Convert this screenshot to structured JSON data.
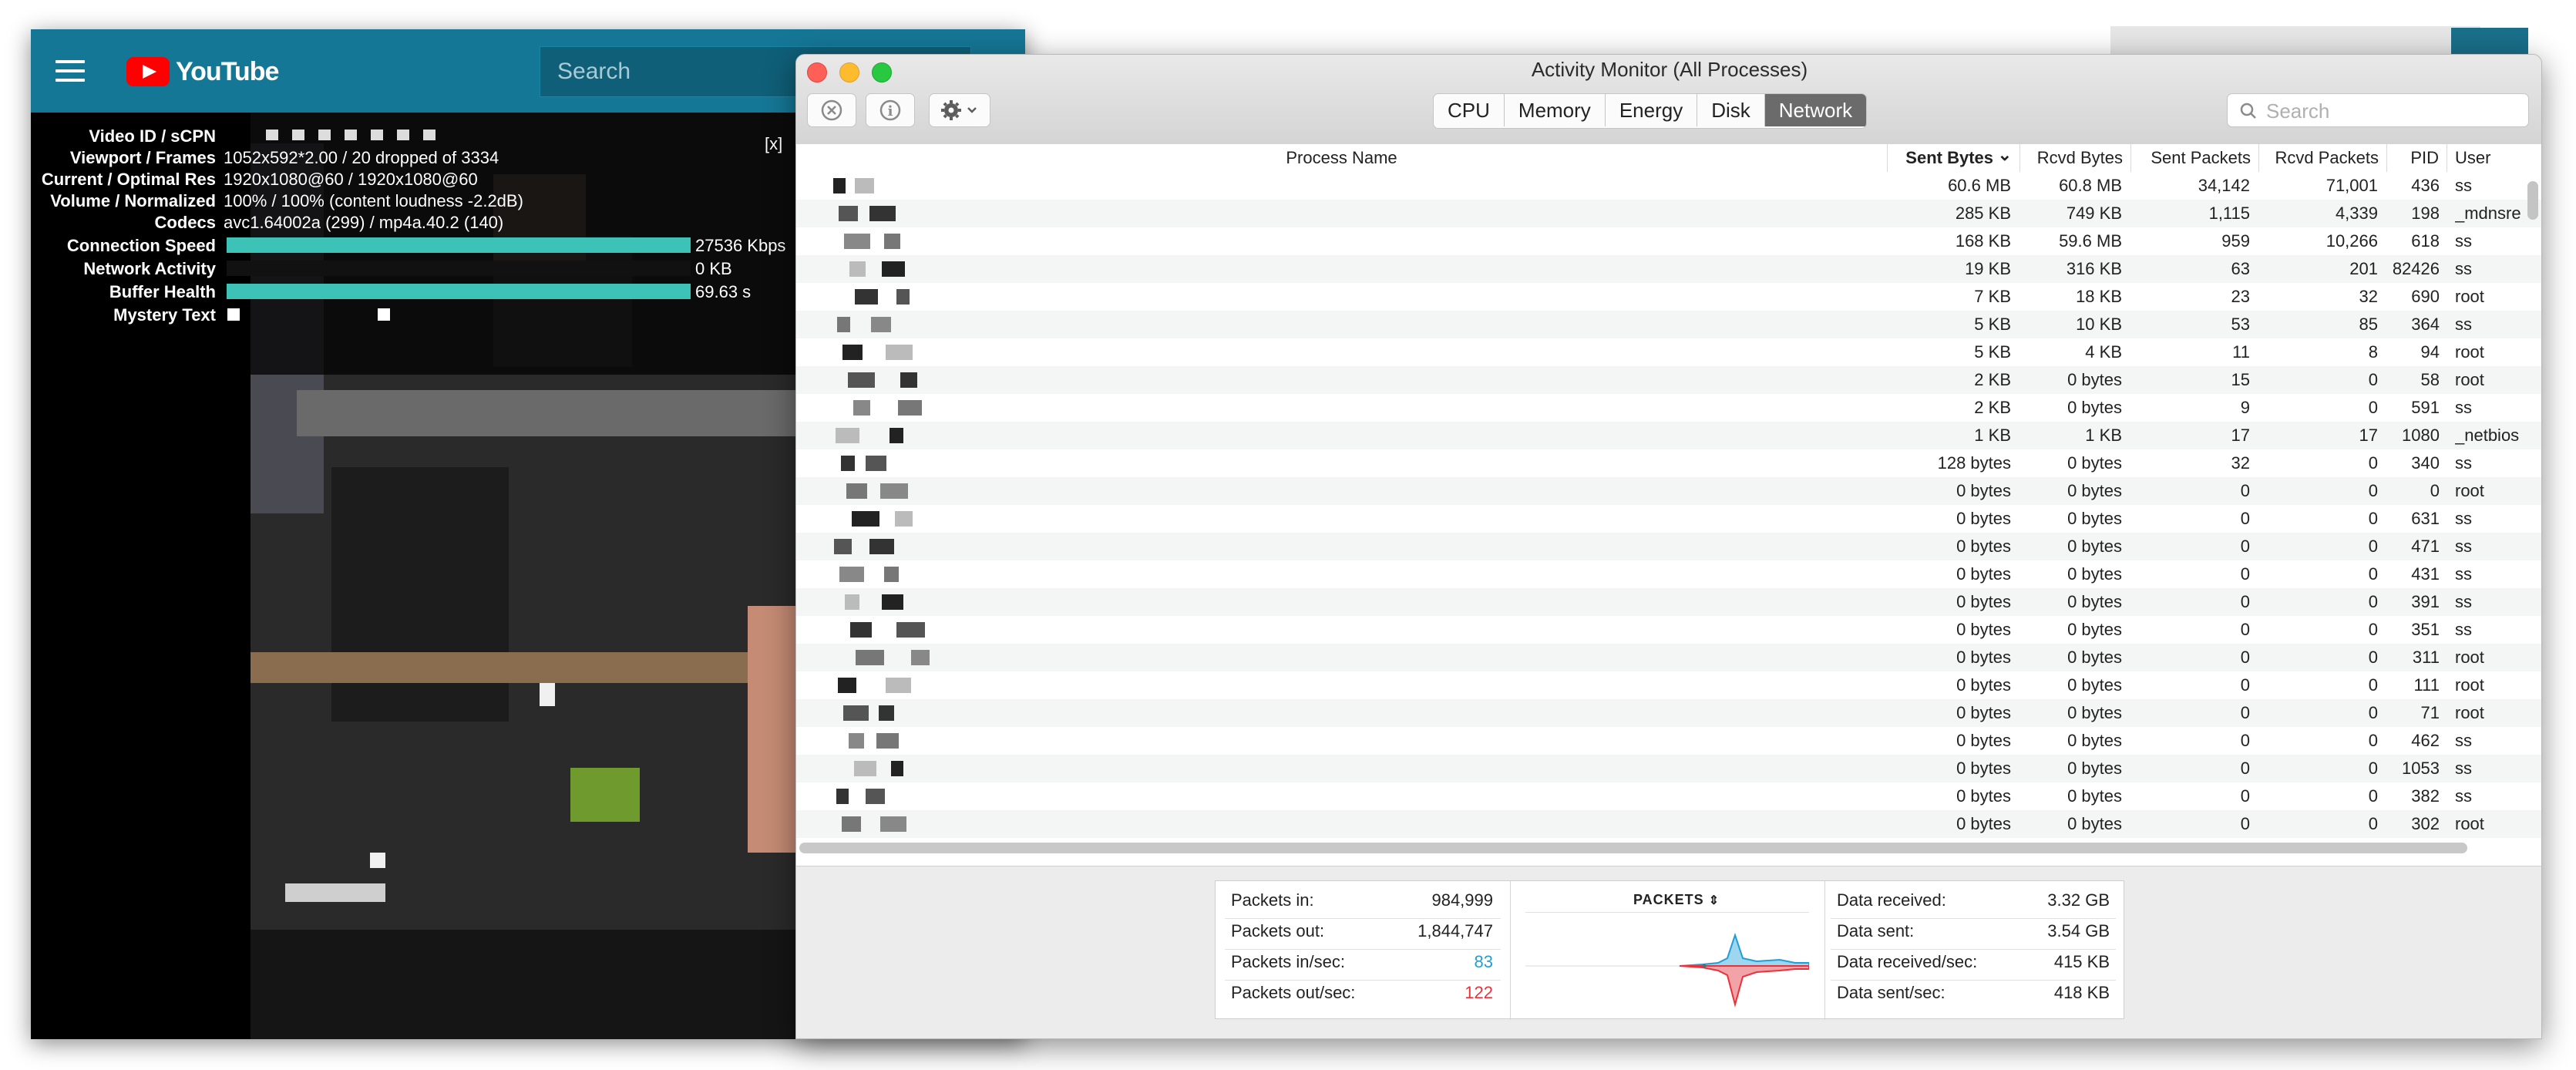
{
  "youtube": {
    "logo_text": "YouTube",
    "search_placeholder": "Search",
    "stats": [
      {
        "label": "Video ID / sCPN",
        "value": ""
      },
      {
        "label": "Viewport / Frames",
        "value": "1052x592*2.00 / 20 dropped of 3334"
      },
      {
        "label": "Current / Optimal Res",
        "value": "1920x1080@60 / 1920x1080@60"
      },
      {
        "label": "Volume / Normalized",
        "value": "100% / 100% (content loudness -2.2dB)"
      },
      {
        "label": "Codecs",
        "value": "avc1.64002a (299) / mp4a.40.2 (140)"
      },
      {
        "label": "Connection Speed",
        "value": "27536 Kbps",
        "fill": 1.0
      },
      {
        "label": "Network Activity",
        "value": "0 KB",
        "fill": 0.0
      },
      {
        "label": "Buffer Health",
        "value": "69.63 s",
        "fill": 1.0
      },
      {
        "label": "Mystery Text",
        "value": ""
      }
    ],
    "close_label": "[x]",
    "colors": {
      "header": "#157796",
      "bar_dark": "#0e8f9b",
      "bar_light": "#3cc2b6"
    }
  },
  "activity_monitor": {
    "title": "Activity Monitor (All Processes)",
    "toolbar_icons": [
      "close-process-icon",
      "info-icon",
      "gear-icon"
    ],
    "tabs": [
      {
        "label": "CPU",
        "active": false
      },
      {
        "label": "Memory",
        "active": false
      },
      {
        "label": "Energy",
        "active": false
      },
      {
        "label": "Disk",
        "active": false
      },
      {
        "label": "Network",
        "active": true
      }
    ],
    "search_placeholder": "Search",
    "columns": [
      "Process Name",
      "Sent Bytes",
      "Rcvd Bytes",
      "Sent Packets",
      "Rcvd Packets",
      "PID",
      "User"
    ],
    "sort_indicator": "⌄",
    "rows": [
      {
        "sent": "60.6 MB",
        "rcvd": "60.8 MB",
        "spk": "34,142",
        "rpk": "71,001",
        "pid": "436",
        "user": "ss"
      },
      {
        "sent": "285 KB",
        "rcvd": "749 KB",
        "spk": "1,115",
        "rpk": "4,339",
        "pid": "198",
        "user": "_mdnsre"
      },
      {
        "sent": "168 KB",
        "rcvd": "59.6 MB",
        "spk": "959",
        "rpk": "10,266",
        "pid": "618",
        "user": "ss"
      },
      {
        "sent": "19 KB",
        "rcvd": "316 KB",
        "spk": "63",
        "rpk": "201",
        "pid": "82426",
        "user": "ss"
      },
      {
        "sent": "7 KB",
        "rcvd": "18 KB",
        "spk": "23",
        "rpk": "32",
        "pid": "690",
        "user": "root"
      },
      {
        "sent": "5 KB",
        "rcvd": "10 KB",
        "spk": "53",
        "rpk": "85",
        "pid": "364",
        "user": "ss"
      },
      {
        "sent": "5 KB",
        "rcvd": "4 KB",
        "spk": "11",
        "rpk": "8",
        "pid": "94",
        "user": "root"
      },
      {
        "sent": "2 KB",
        "rcvd": "0 bytes",
        "spk": "15",
        "rpk": "0",
        "pid": "58",
        "user": "root"
      },
      {
        "sent": "2 KB",
        "rcvd": "0 bytes",
        "spk": "9",
        "rpk": "0",
        "pid": "591",
        "user": "ss"
      },
      {
        "sent": "1 KB",
        "rcvd": "1 KB",
        "spk": "17",
        "rpk": "17",
        "pid": "1080",
        "user": "_netbios"
      },
      {
        "sent": "128 bytes",
        "rcvd": "0 bytes",
        "spk": "32",
        "rpk": "0",
        "pid": "340",
        "user": "ss"
      },
      {
        "sent": "0 bytes",
        "rcvd": "0 bytes",
        "spk": "0",
        "rpk": "0",
        "pid": "0",
        "user": "root"
      },
      {
        "sent": "0 bytes",
        "rcvd": "0 bytes",
        "spk": "0",
        "rpk": "0",
        "pid": "631",
        "user": "ss"
      },
      {
        "sent": "0 bytes",
        "rcvd": "0 bytes",
        "spk": "0",
        "rpk": "0",
        "pid": "471",
        "user": "ss"
      },
      {
        "sent": "0 bytes",
        "rcvd": "0 bytes",
        "spk": "0",
        "rpk": "0",
        "pid": "431",
        "user": "ss"
      },
      {
        "sent": "0 bytes",
        "rcvd": "0 bytes",
        "spk": "0",
        "rpk": "0",
        "pid": "391",
        "user": "ss"
      },
      {
        "sent": "0 bytes",
        "rcvd": "0 bytes",
        "spk": "0",
        "rpk": "0",
        "pid": "351",
        "user": "ss"
      },
      {
        "sent": "0 bytes",
        "rcvd": "0 bytes",
        "spk": "0",
        "rpk": "0",
        "pid": "311",
        "user": "root"
      },
      {
        "sent": "0 bytes",
        "rcvd": "0 bytes",
        "spk": "0",
        "rpk": "0",
        "pid": "111",
        "user": "root"
      },
      {
        "sent": "0 bytes",
        "rcvd": "0 bytes",
        "spk": "0",
        "rpk": "0",
        "pid": "71",
        "user": "root"
      },
      {
        "sent": "0 bytes",
        "rcvd": "0 bytes",
        "spk": "0",
        "rpk": "0",
        "pid": "462",
        "user": "ss"
      },
      {
        "sent": "0 bytes",
        "rcvd": "0 bytes",
        "spk": "0",
        "rpk": "0",
        "pid": "1053",
        "user": "ss"
      },
      {
        "sent": "0 bytes",
        "rcvd": "0 bytes",
        "spk": "0",
        "rpk": "0",
        "pid": "382",
        "user": "ss"
      },
      {
        "sent": "0 bytes",
        "rcvd": "0 bytes",
        "spk": "0",
        "rpk": "0",
        "pid": "302",
        "user": "root"
      }
    ],
    "summary_left": [
      {
        "label": "Packets in:",
        "value": "984,999"
      },
      {
        "label": "Packets out:",
        "value": "1,844,747"
      },
      {
        "label": "Packets in/sec:",
        "value": "83"
      },
      {
        "label": "Packets out/sec:",
        "value": "122"
      }
    ],
    "graph_title": "PACKETS",
    "summary_right": [
      {
        "label": "Data received:",
        "value": "3.32 GB"
      },
      {
        "label": "Data sent:",
        "value": "3.54 GB"
      },
      {
        "label": "Data received/sec:",
        "value": "415 KB"
      },
      {
        "label": "Data sent/sec:",
        "value": "418 KB"
      }
    ],
    "colors": {
      "in": "#1f9fd8",
      "out": "#e8323c",
      "active_tab": "#6b6b6b"
    }
  }
}
